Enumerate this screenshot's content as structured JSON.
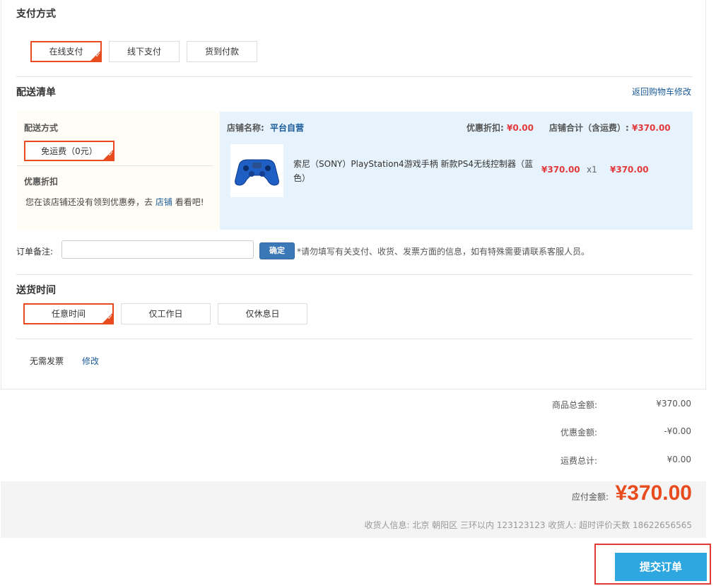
{
  "payment": {
    "title": "支付方式",
    "options": [
      "在线支付",
      "线下支付",
      "货到付款"
    ]
  },
  "delivery_list": {
    "title": "配送清单",
    "back_link": "返回购物车修改",
    "method_label": "配送方式",
    "method_option": "免运费（0元）",
    "discount_label": "优惠折扣",
    "discount_note_prefix": "您在该店铺还没有领到优惠券，去",
    "discount_note_link": "店铺",
    "discount_note_suffix": "看看吧!",
    "store_label": "店铺名称:",
    "store_name": "平台自营",
    "store_discount_label": "优惠折扣:",
    "store_discount_value": "¥0.00",
    "store_total_label": "店铺合计（含运费）:",
    "store_total_value": "¥370.00",
    "product": {
      "name": "索尼（SONY）PlayStation4游戏手柄 新款PS4无线控制器（蓝色）",
      "price": "¥370.00",
      "qty": "x1",
      "subtotal": "¥370.00"
    }
  },
  "remark": {
    "label": "订单备注:",
    "value": "",
    "confirm_label": "确定",
    "hint": "*请勿填写有关支付、收货、发票方面的信息，如有特殊需要请联系客服人员。"
  },
  "delivery_time": {
    "title": "送货时间",
    "options": [
      "任意时间",
      "仅工作日",
      "仅休息日"
    ]
  },
  "invoice": {
    "text": "无需发票",
    "edit_label": "修改"
  },
  "summary": {
    "goods_total_label": "商品总金额:",
    "goods_total_value": "¥370.00",
    "discount_label": "优惠金额:",
    "discount_value": "-¥0.00",
    "shipping_label": "运费总计:",
    "shipping_value": "¥0.00",
    "payable_label": "应付金额:",
    "payable_value": "¥370.00",
    "receiver_info": "收货人信息: 北京 朝阳区 三环以内 123123123 收货人: 超时评价天数 18622656565"
  },
  "submit": {
    "label": "提交订单"
  },
  "colors": {
    "accent_orange": "#e84c1e",
    "price_red": "#e4393c",
    "link_blue": "#1a5a9a",
    "submit_blue": "#2ea7e0"
  }
}
